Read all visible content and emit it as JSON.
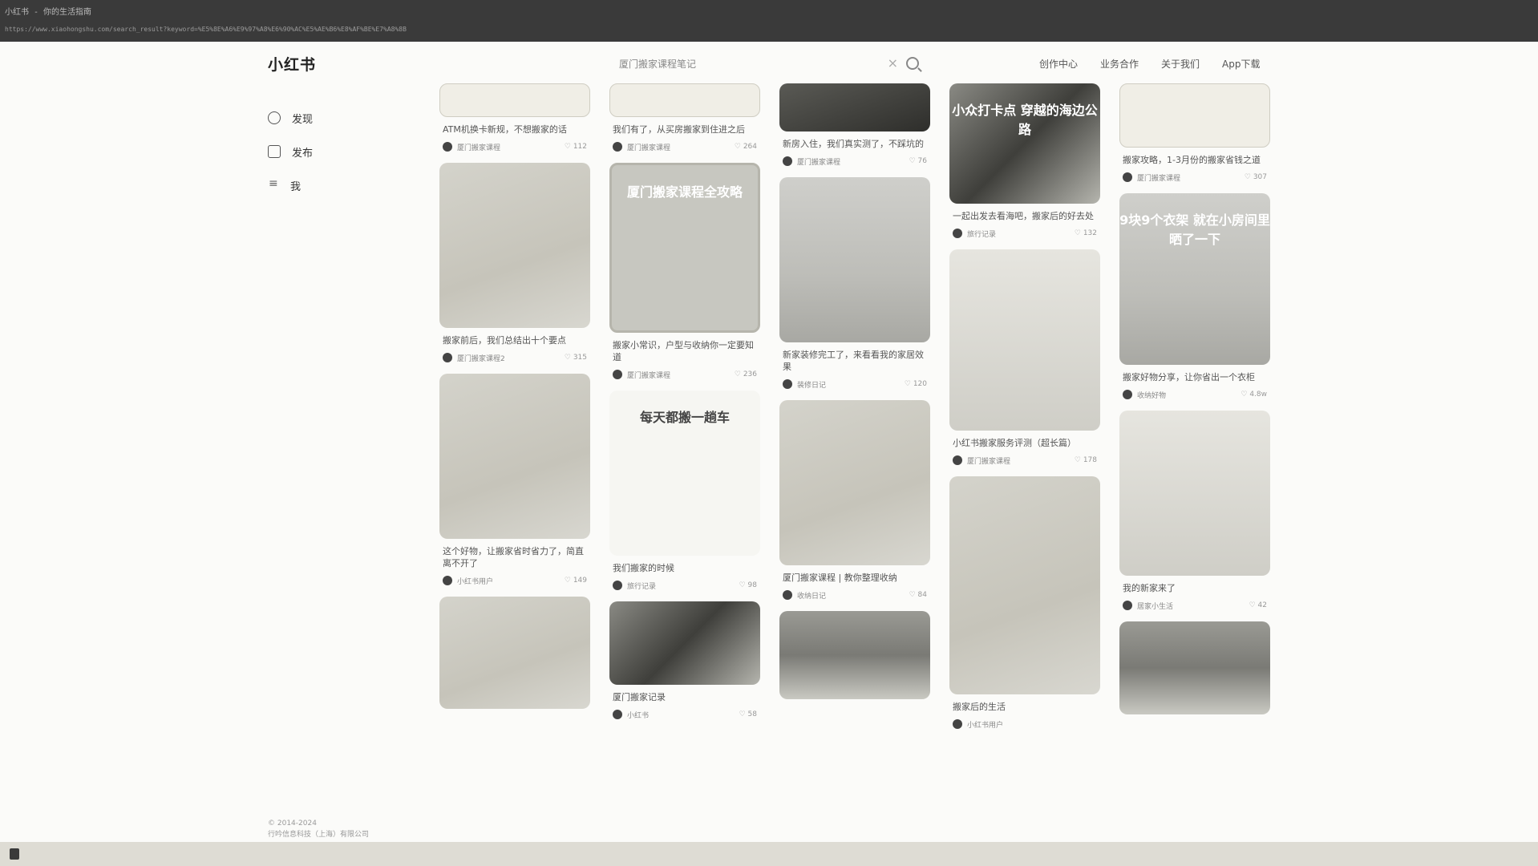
{
  "window": {
    "title": "小红书 - 你的生活指南",
    "url": "https://www.xiaohongshu.com/search_result?keyword=%E5%8E%A6%E9%97%A8%E6%90%AC%E5%AE%B6%E8%AF%BE%E7%A8%8B"
  },
  "header": {
    "logo": "小红书",
    "search_text": "厦门搬家课程笔记",
    "nav": [
      "创作中心",
      "业务合作",
      "关于我们",
      "App下载"
    ]
  },
  "sidebar": {
    "items": [
      {
        "label": "发现",
        "icon": "compass-icon"
      },
      {
        "label": "发布",
        "icon": "plus-square-icon"
      },
      {
        "label": "我",
        "icon": "user-icon"
      }
    ],
    "footer": [
      "© 2014-2024",
      "行吟信息科技（上海）有限公司"
    ]
  },
  "columns": [
    [
      {
        "style": "doc",
        "h": 40,
        "title": "ATM机换卡新规，不想搬家的话",
        "author": "厦门搬家课程",
        "likes": "112"
      },
      {
        "style": "soft",
        "h": 206,
        "title": "搬家前后，我们总结出十个要点",
        "author": "厦门搬家课程2",
        "likes": "315"
      },
      {
        "style": "soft",
        "h": 206,
        "title": "这个好物，让搬家省时省力了，简直离不开了",
        "author": "小红书用户",
        "likes": "149"
      },
      {
        "style": "soft",
        "h": 140,
        "title": "",
        "author": "",
        "likes": ""
      }
    ],
    [
      {
        "style": "doc",
        "h": 40,
        "title": "我们有了，从买房搬家到住进之后",
        "author": "厦门搬家课程",
        "likes": "264"
      },
      {
        "style": "plan",
        "h": 206,
        "overlay": "厦门搬家课程全攻略",
        "title": "搬家小常识，户型与收纳你一定要知道",
        "author": "厦门搬家课程",
        "likes": "236"
      },
      {
        "style": "car",
        "h": 206,
        "overlay": "每天都搬一趟车",
        "overlay_dark": true,
        "title": "我们搬家的时候",
        "author": "旅行记录",
        "likes": "98"
      },
      {
        "style": "photo",
        "h": 104,
        "title": "厦门搬家记录",
        "author": "小红书",
        "likes": "58"
      }
    ],
    [
      {
        "style": "dark",
        "h": 60,
        "title": "新房入住，我们真实测了，不踩坑的",
        "author": "厦门搬家课程",
        "likes": "76"
      },
      {
        "style": "room",
        "h": 206,
        "title": "新家装修完工了，来看看我的家居效果",
        "author": "装修日记",
        "likes": "120"
      },
      {
        "style": "soft",
        "h": 206,
        "title": "厦门搬家课程 | 教你整理收纳",
        "author": "收纳日记",
        "likes": "84"
      },
      {
        "style": "road",
        "h": 110,
        "title": "",
        "author": "",
        "likes": ""
      }
    ],
    [
      {
        "style": "photo",
        "h": 150,
        "overlay": "小众打卡点 穿越的海边公路",
        "title": "一起出发去看海吧，搬家后的好去处",
        "author": "旅行记录",
        "likes": "132"
      },
      {
        "style": "light",
        "h": 226,
        "title": "小红书搬家服务评测（超长篇）",
        "author": "厦门搬家课程",
        "likes": "178"
      },
      {
        "style": "soft",
        "h": 272,
        "title": "搬家后的生活",
        "author": "小红书用户",
        "likes": ""
      }
    ],
    [
      {
        "style": "doc",
        "h": 78,
        "title": "搬家攻略，1-3月份的搬家省钱之道",
        "author": "厦门搬家课程",
        "likes": "307"
      },
      {
        "style": "room",
        "h": 214,
        "overlay": "9块9个衣架 就在小房间里晒了一下",
        "title": "搬家好物分享，让你省出一个衣柜",
        "author": "收纳好物",
        "likes": "4.8w"
      },
      {
        "style": "light",
        "h": 206,
        "title": "我的新家来了",
        "author": "居家小生活",
        "likes": "42"
      },
      {
        "style": "road",
        "h": 116,
        "title": "",
        "author": "",
        "likes": ""
      }
    ]
  ]
}
